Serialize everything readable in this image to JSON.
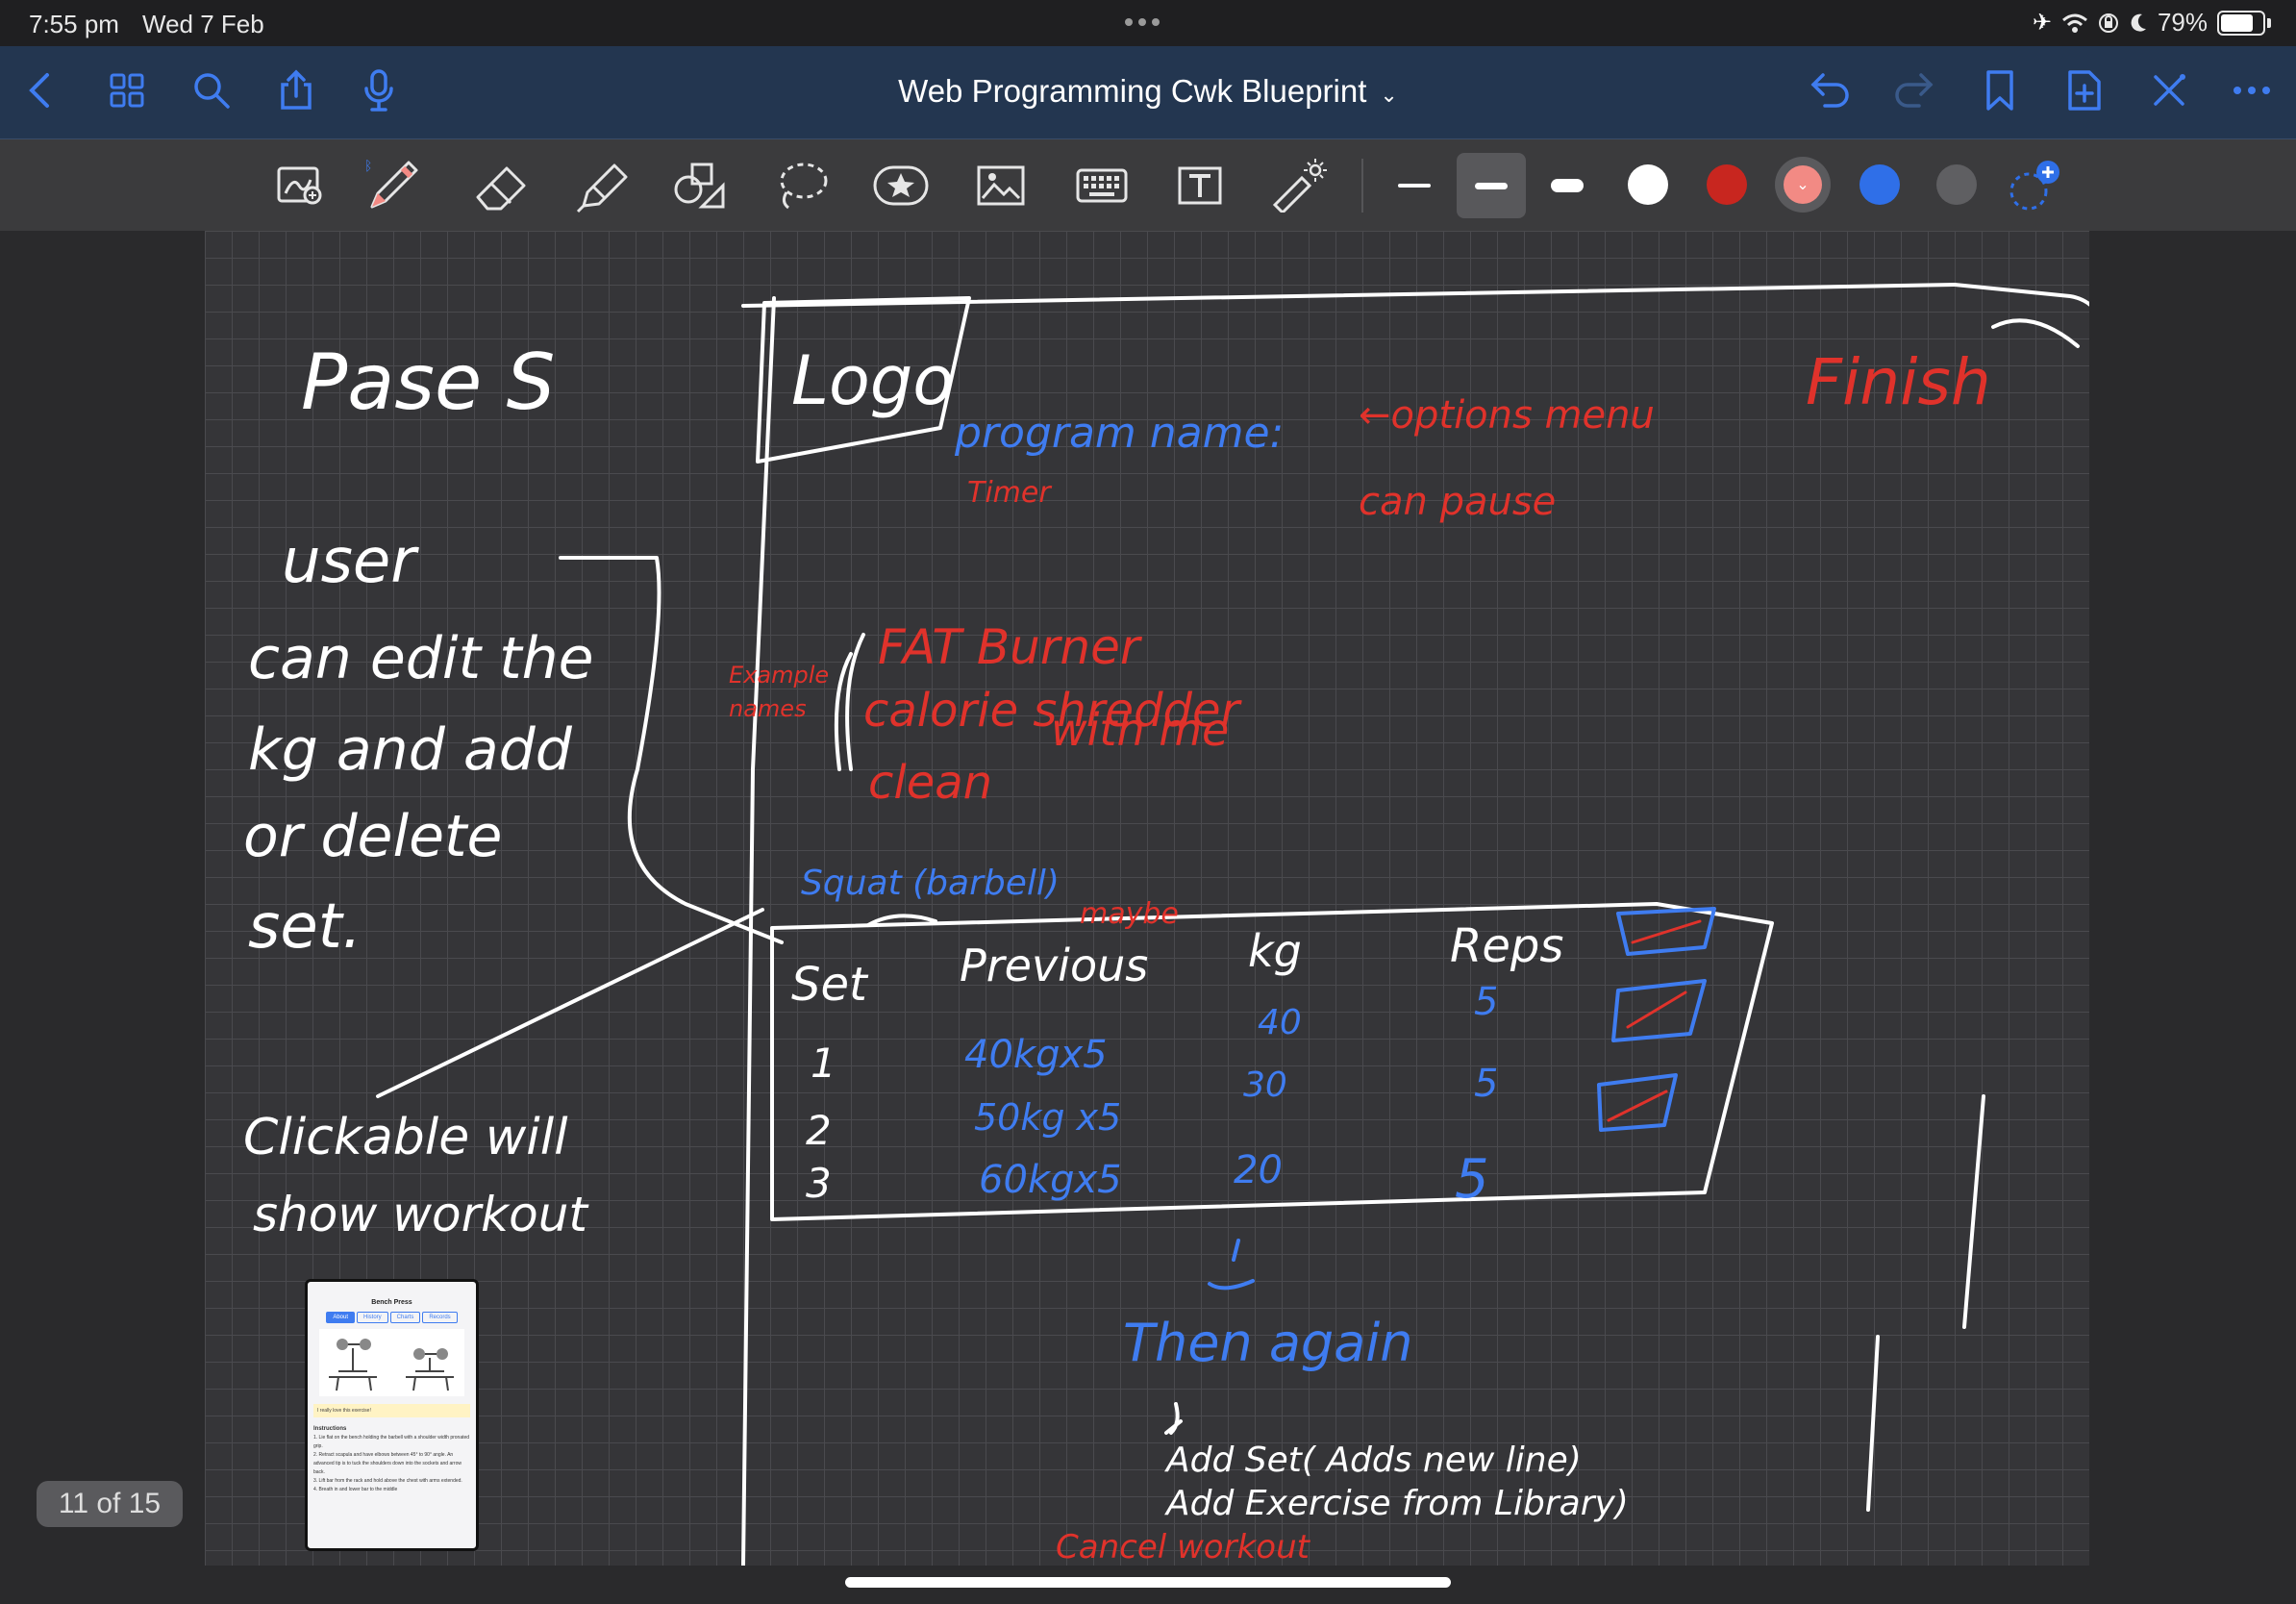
{
  "status_bar": {
    "time": "7:55 pm",
    "date": "Wed 7 Feb",
    "battery_percent": "79%",
    "battery_level": 0.79,
    "icons": [
      "airplane-icon",
      "wifi-icon",
      "orientation-lock-icon",
      "moon-icon",
      "battery-icon"
    ]
  },
  "nav": {
    "title": "Web Programming Cwk Blueprint",
    "left_icons": [
      "back-chevron-icon",
      "grid-icon",
      "search-icon",
      "share-icon",
      "microphone-icon"
    ],
    "right_icons": [
      "undo-icon",
      "redo-icon",
      "bookmark-icon",
      "add-page-icon",
      "close-x-icon",
      "more-icon"
    ]
  },
  "toolbar": {
    "tools": [
      "image-zoom-icon",
      "pen-icon",
      "eraser-icon",
      "highlighter-icon",
      "shapes-icon",
      "lasso-icon",
      "sticker-icon",
      "image-icon",
      "keyboard-icon",
      "text-box-icon",
      "laser-pointer-icon"
    ],
    "selected_tool": "pen-icon",
    "stroke_widths": [
      "thin",
      "medium",
      "thick"
    ],
    "selected_width": "medium",
    "colors": [
      "#ffffff",
      "#d42a22",
      "#f28a84",
      "#2f6fe8",
      "#5f5f62"
    ],
    "selected_color": "#f28a84",
    "accent": "#2f6fe8"
  },
  "canvas": {
    "page_indicator": "11 of 15"
  },
  "notes": {
    "page_heading": "Pase S",
    "logo": "Logo",
    "finish": "Finish",
    "program_name": "program name:",
    "options_menu": "←options menu",
    "can_pause": "can pause",
    "timer": "Timer",
    "example_names_1": "Example",
    "example_names_2": "names",
    "name_fat": "FAT Burner",
    "name_calorie": "calorie shredder",
    "name_clean": "clean",
    "name_with_me": "with me",
    "user_1": "user",
    "user_2": "can edit the",
    "user_3": "kg and add",
    "user_4": "or delete",
    "user_5": "set.",
    "exercise_label": "Squat (barbell)",
    "maybe": "maybe",
    "col_set": "Set",
    "col_previous": "Previous",
    "col_kg": "kg",
    "col_reps": "Reps",
    "rows": [
      {
        "set": "1",
        "previous": "40kgx5",
        "kg": "40",
        "reps": "5"
      },
      {
        "set": "2",
        "previous": "50kg x5",
        "kg": "30",
        "reps": "5"
      },
      {
        "set": "3",
        "previous": "60kgx5",
        "kg": "20",
        "reps": "5"
      }
    ],
    "clickable_1": "Clickable will",
    "clickable_2": "show workout",
    "then_again": "Then again",
    "add_set": "Add Set( Adds new line)",
    "add_exercise": "Add Exercise from Library)",
    "cancel_workout": "Cancel workout"
  },
  "phone_screenshot": {
    "title": "Bench Press",
    "tabs": [
      "About",
      "History",
      "Charts",
      "Records"
    ],
    "note": "I really love this exercise!",
    "instructions_heading": "Instructions",
    "instructions": [
      "1. Lie flat on the bench holding the barbell with a shoulder width pronated grip.",
      "2. Retract scapula and have elbows between 45° to 90° angle. An advanced tip is to tuck the shoulders down into the sockets and arrow back.",
      "3. Lift bar from the rack and hold above the chest with arms extended.",
      "4. Breath in and lower bar to the middle"
    ]
  }
}
